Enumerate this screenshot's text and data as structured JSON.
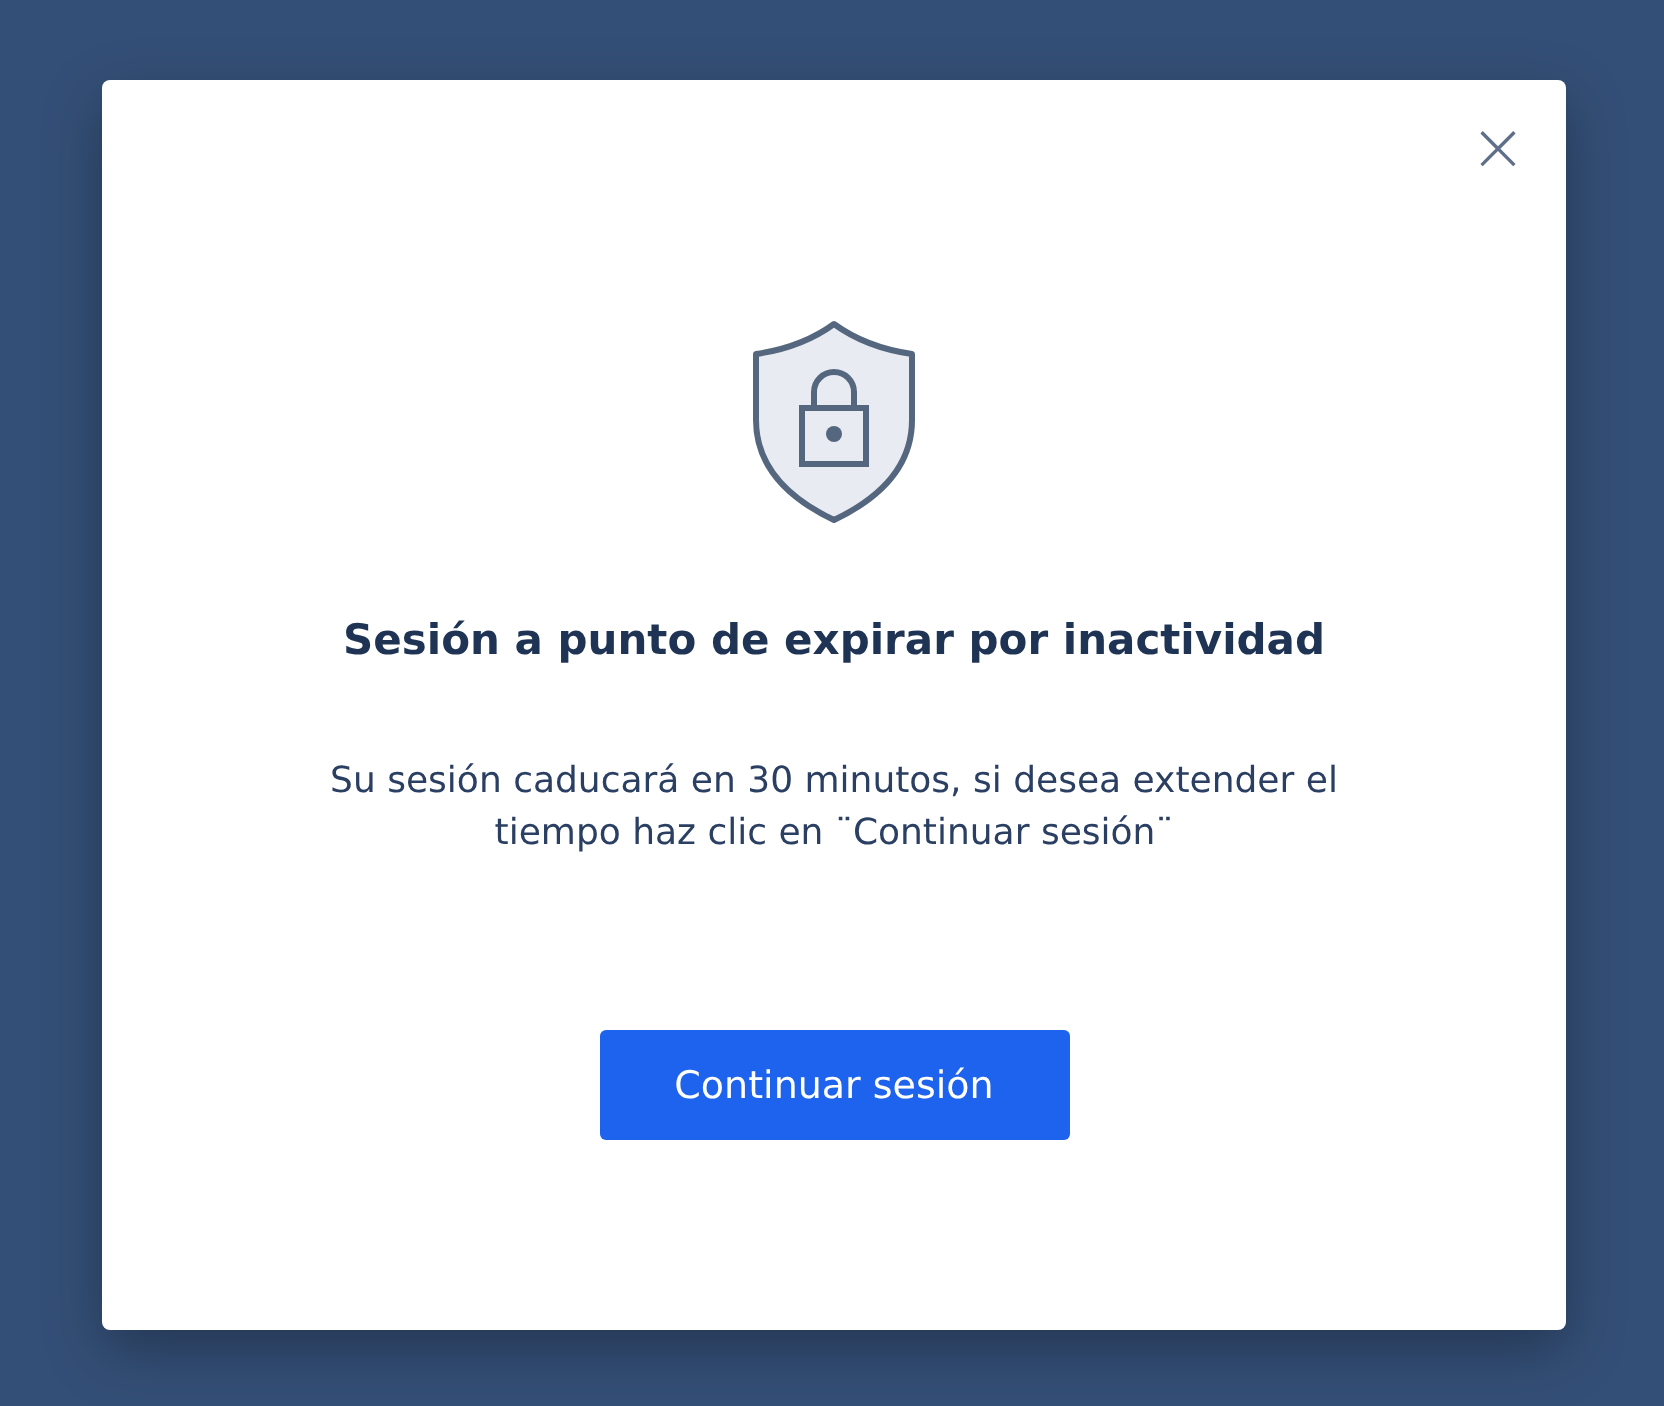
{
  "dialog": {
    "close_button": "×",
    "title": "Sesión a punto de expirar por inactividad",
    "message": "Su sesión caducará en 30 minutos, si desea extender el tiempo haz clic en ¨Continuar sesión¨",
    "buttons": [
      "Continuar sesión"
    ]
  }
}
